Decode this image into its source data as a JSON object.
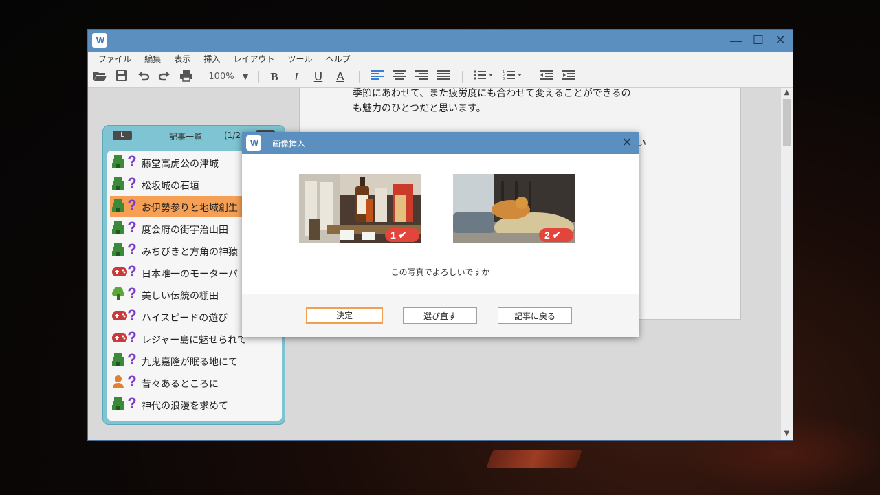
{
  "window": {
    "app_icon": "W",
    "controls": {
      "minimize": "—",
      "maximize": "☐",
      "close": "✕"
    }
  },
  "menu": [
    "ファイル",
    "編集",
    "表示",
    "挿入",
    "レイアウト",
    "ツール",
    "ヘルプ"
  ],
  "toolbar": {
    "zoom": "100%",
    "icons": [
      "open-folder-icon",
      "save-icon",
      "undo-icon",
      "redo-icon",
      "print-icon",
      "bold-icon",
      "italic-icon",
      "underline-icon",
      "font-color-icon",
      "align-left-icon",
      "align-center-icon",
      "align-right-icon",
      "justify-icon",
      "bullet-list-icon",
      "numbered-list-icon",
      "outdent-icon",
      "indent-icon"
    ],
    "bold": "B",
    "italic": "I",
    "underline": "U",
    "font_color": "A"
  },
  "document": {
    "line1": "季節にあわせて、また疲労度にも合わせて変えることができるの",
    "line2": "も魅力のひとつだと思います。",
    "line3_fragment": "い"
  },
  "article_panel": {
    "badge": "L",
    "title": "記事一覧",
    "page": "(1/2",
    "items": [
      {
        "label": "藤堂高虎公の津城",
        "icon": "green-castle-icon",
        "q": "?"
      },
      {
        "label": "松坂城の石垣",
        "icon": "green-castle-icon",
        "q": "?"
      },
      {
        "label": "お伊勢参りと地域創生",
        "icon": "green-castle-icon",
        "q": "?",
        "selected": true
      },
      {
        "label": "度会府の街宇治山田",
        "icon": "green-castle-icon",
        "q": "?"
      },
      {
        "label": "みちびきと方角の神猿",
        "icon": "green-castle-icon",
        "q": "?"
      },
      {
        "label": "日本唯一のモーターパ",
        "icon": "red-gamepad-icon",
        "q": "?"
      },
      {
        "label": "美しい伝統の棚田",
        "icon": "green-tree-icon",
        "q": "?"
      },
      {
        "label": "ハイスピードの遊び",
        "icon": "red-gamepad-icon",
        "q": "?"
      },
      {
        "label": "レジャー島に魅せられて",
        "icon": "red-gamepad-icon",
        "q": "?"
      },
      {
        "label": "九鬼嘉隆が眠る地にて",
        "icon": "green-castle-icon",
        "q": "?"
      },
      {
        "label": "昔々あるところに",
        "icon": "orange-person-icon",
        "q": "?"
      },
      {
        "label": "神代の浪漫を求めて",
        "icon": "green-castle-icon",
        "q": "?"
      }
    ]
  },
  "dialog": {
    "icon": "W",
    "title": "画像挿入",
    "close": "✕",
    "photos": [
      {
        "badge": "1 ✔",
        "icon": "sake-bottles-photo"
      },
      {
        "badge": "2 ✔",
        "icon": "cat-on-rice-bales-photo"
      }
    ],
    "question": "この写真でよろしいですか",
    "buttons": {
      "confirm": "決定",
      "reselect": "選び直す",
      "back": "記事に戻る"
    }
  }
}
